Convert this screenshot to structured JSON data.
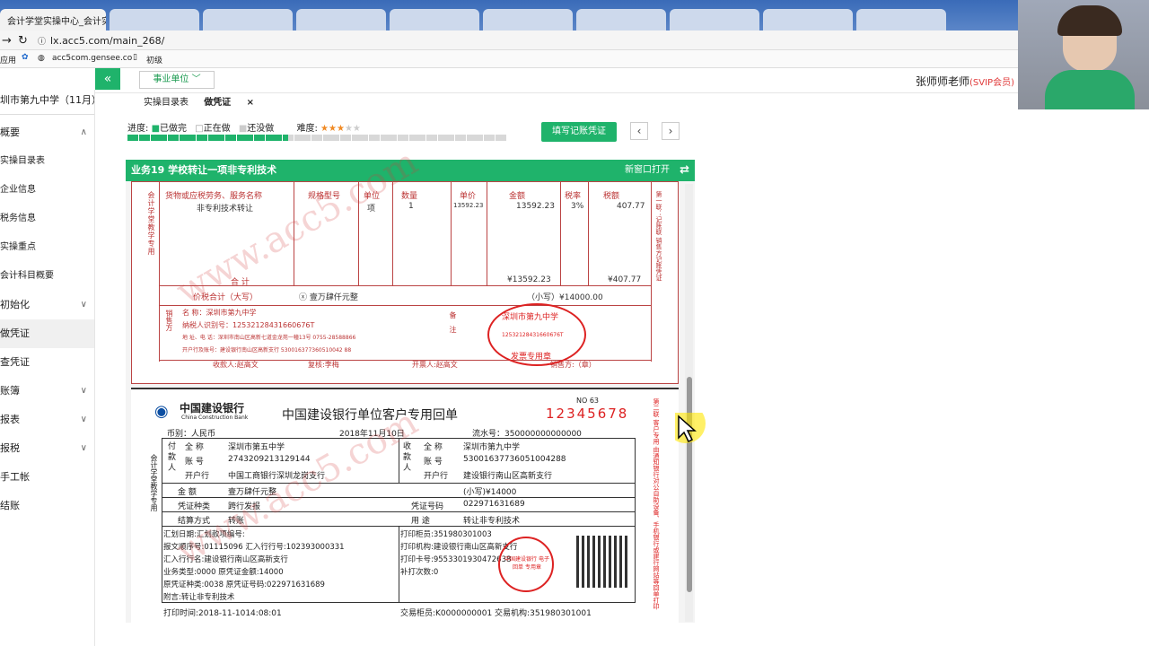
{
  "browser": {
    "tab1": "会计学堂实操中心_会计实",
    "url": "lx.acc5.com/main_268/",
    "bookmarks": [
      "应用",
      "acc5com.gensee.co",
      "初级"
    ]
  },
  "app": {
    "unit_dropdown": "事业单位 ﹀",
    "teacher": "张师师老师",
    "vip": "(SVIP会员)",
    "collapse_icon": "«"
  },
  "sidebar": {
    "company": "圳市第九中学（11月）",
    "items": [
      {
        "label": "概要",
        "chev": "∧"
      },
      {
        "label": "实操目录表"
      },
      {
        "label": "企业信息"
      },
      {
        "label": "税务信息"
      },
      {
        "label": "实操重点"
      },
      {
        "label": "会计科目概要"
      },
      {
        "label": "初始化",
        "chev": "∨"
      },
      {
        "label": "做凭证"
      },
      {
        "label": "查凭证"
      },
      {
        "label": "账簿",
        "chev": "∨"
      },
      {
        "label": "报表",
        "chev": "∨"
      },
      {
        "label": "报税",
        "chev": "∨"
      },
      {
        "label": "手工帐"
      },
      {
        "label": "结账"
      }
    ]
  },
  "tabs": {
    "t1": "实操目录表",
    "t2": "做凭证",
    "close": "×"
  },
  "progress": {
    "label": "进度:",
    "done": "已做完",
    "doing": "正在做",
    "todo": "还没做",
    "difficulty": "难度:",
    "done_count": 28,
    "total": 66
  },
  "buttons": {
    "fill": "填写记账凭证",
    "prev": "‹",
    "next": "›"
  },
  "task": {
    "title": "业务19 学校转让一项非专利技术",
    "newwin": "新窗口打开",
    "swap_icon": "⇄"
  },
  "invoice": {
    "side": "会计学堂教学专用",
    "cols": [
      "货物或应税劳务、服务名称",
      "规格型号",
      "单位",
      "数量",
      "单价",
      "金额",
      "税率",
      "税额"
    ],
    "row": [
      "非专利技术转让",
      "",
      "项",
      "1",
      "13592.23",
      "13592.23",
      "3%",
      "407.77"
    ],
    "total_label": "合 计",
    "total_amt": "¥13592.23",
    "total_tax": "¥407.77",
    "sum_label": "价税合计（大写）",
    "sum_words": "ⓧ 壹万肆仟元整",
    "sum_small": "（小写）¥14000.00",
    "seller_side": "销售方",
    "seller": [
      "名 称：深圳市第九中学",
      "纳税人识别号：12532128431660676T",
      "地 址、电 话：深圳市南山区高新七道金龙苑一幢13号 0755-28588866",
      "开户行及账号：建设银行南山区高新支行 530016377360510042 88"
    ],
    "remark": "备注",
    "stamp_top": "深圳市第九中学",
    "stamp_mid": "12532128431660676T",
    "stamp_bot": "发票专用章",
    "footer": [
      "收款人:赵高文",
      "复核:李梅",
      "开票人:赵高文",
      "销售方:（章）"
    ],
    "right": "第一联：记账联 销售方记账凭证"
  },
  "slip": {
    "bank": "中国建设银行",
    "bank_en": "China Construction Bank",
    "title": "中国建设银行单位客户专用回单",
    "no": "NO 63",
    "serial": "12345678",
    "currency": "币别：人民币",
    "date": "2018年11月10日",
    "flow": "流水号：350000000000000",
    "payer": "付款人",
    "payee": "收款人",
    "p_name_l": "全 称",
    "p_name": "深圳市第五中学",
    "p_acct_l": "账 号",
    "p_acct": "2743209213129144",
    "p_bank_l": "开户行",
    "p_bank": "中国工商银行深圳龙岗支行",
    "r_name": "深圳市第九中学",
    "r_acct": "53001637736051004288",
    "r_bank": "建设银行南山区高新支行",
    "amt_l": "金 额",
    "amt": "壹万肆仟元整",
    "amt_small": "(小写)¥14000",
    "vtype_l": "凭证种类",
    "vtype": "跨行发报",
    "vno_l": "凭证号码",
    "vno": "022971631689",
    "settle_l": "结算方式",
    "settle": "转账",
    "use_l": "用 途",
    "use": "转让非专利技术",
    "left_lines": [
      "汇划日期:汇划款项编号:",
      "报文顺序号:01115096 汇入行行号:102393000331",
      "汇入行行名:建设银行南山区高新支行",
      "业务类型:0000 原凭证金额:14000",
      "原凭证种类:0038 原凭证号码:022971631689",
      "附言:转让非专利技术"
    ],
    "mid_lines": [
      "打印柜员:351980301003",
      "打印机构:建设银行南山区高新支行",
      "打印卡号:9553301930472638",
      "补打次数:0"
    ],
    "stamp": "中国建设银行 电子回单 专用章",
    "print_time": "打印时间:2018-11-1014:08:01",
    "teller": "交易柜员:K0000000001 交易机构:351980301001",
    "side": "会计学堂教学专用",
    "right": "第二联 客户专用 由通知银行对公自助设备、手机银行或建行网站等回单打印"
  },
  "watermark": "www.acc5.com"
}
